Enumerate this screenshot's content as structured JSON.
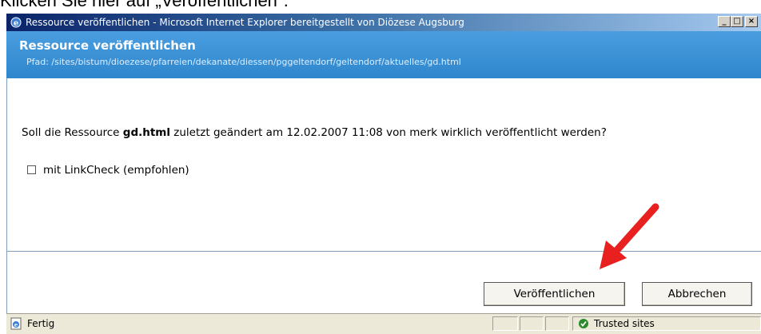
{
  "caption": "Klicken Sie hier auf „Veröffentlichen\".",
  "window": {
    "title": "Ressource veröffentlichen - Microsoft Internet Explorer bereitgestellt von Diözese Augsburg",
    "icon": "ie-icon",
    "controls": [
      "minimize",
      "maximize",
      "close"
    ]
  },
  "dialog": {
    "title": "Ressource veröffentlichen",
    "path": "Pfad: /sites/bistum/dioezese/pfarreien/dekanate/diessen/pggeltendorf/geltendorf/aktuelles/gd.html",
    "question_before": "Soll die Ressource ",
    "question_file": "gd.html",
    "question_after": " zuletzt geändert am 12.02.2007 11:08 von merk wirklich veröffentlicht werden?",
    "linkcheck_label": "mit LinkCheck (empfohlen)",
    "linkcheck_checked": false
  },
  "buttons": {
    "publish": "Veröffentlichen",
    "cancel": "Abbrechen"
  },
  "statusbar": {
    "status": "Fertig",
    "zone": "Trusted sites"
  },
  "colors": {
    "header_bg": "#3a8fd0",
    "arrow": "#e82020"
  }
}
